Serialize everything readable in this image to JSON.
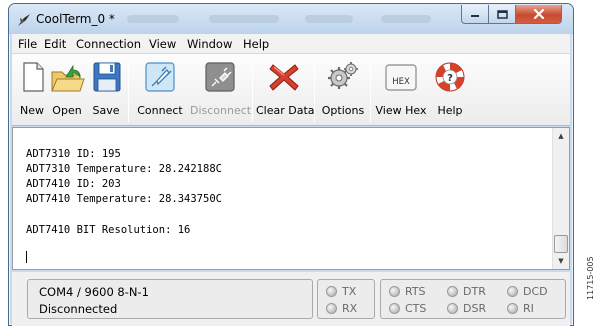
{
  "window": {
    "title": "CoolTerm_0 *"
  },
  "menu": {
    "items": [
      {
        "id": "file",
        "label": "File"
      },
      {
        "id": "edit",
        "label": "Edit"
      },
      {
        "id": "connection",
        "label": "Connection"
      },
      {
        "id": "view",
        "label": "View"
      },
      {
        "id": "window",
        "label": "Window"
      },
      {
        "id": "help",
        "label": "Help"
      }
    ]
  },
  "toolbar": {
    "new": "New",
    "open": "Open",
    "save": "Save",
    "connect": "Connect",
    "disconnect": "Disconnect",
    "clear_data": "Clear Data",
    "options": "Options",
    "view_hex": "View Hex",
    "help": "Help",
    "hex_icon_text": "HEX"
  },
  "terminal": {
    "lines": [
      "ADT7310 ID: 195",
      "ADT7310 Temperature: 28.242188C",
      "ADT7410 ID: 203",
      "ADT7410 Temperature: 28.343750C",
      "",
      "ADT7410 BIT Resolution: 16"
    ]
  },
  "status": {
    "port": "COM4 / 9600 8-N-1",
    "connection": "Disconnected",
    "leds": {
      "tx": "TX",
      "rx": "RX",
      "rts": "RTS",
      "cts": "CTS",
      "dtr": "DTR",
      "dsr": "DSR",
      "dcd": "DCD",
      "ri": "RI"
    }
  },
  "figure_code": "11715-005",
  "colors": {
    "title_bar": "#c9dcef",
    "close_button": "#c74a30",
    "clear_data_x": "#d7402b",
    "connect_icon": "#7fb9e6",
    "save_icon": "#2f6db5"
  }
}
